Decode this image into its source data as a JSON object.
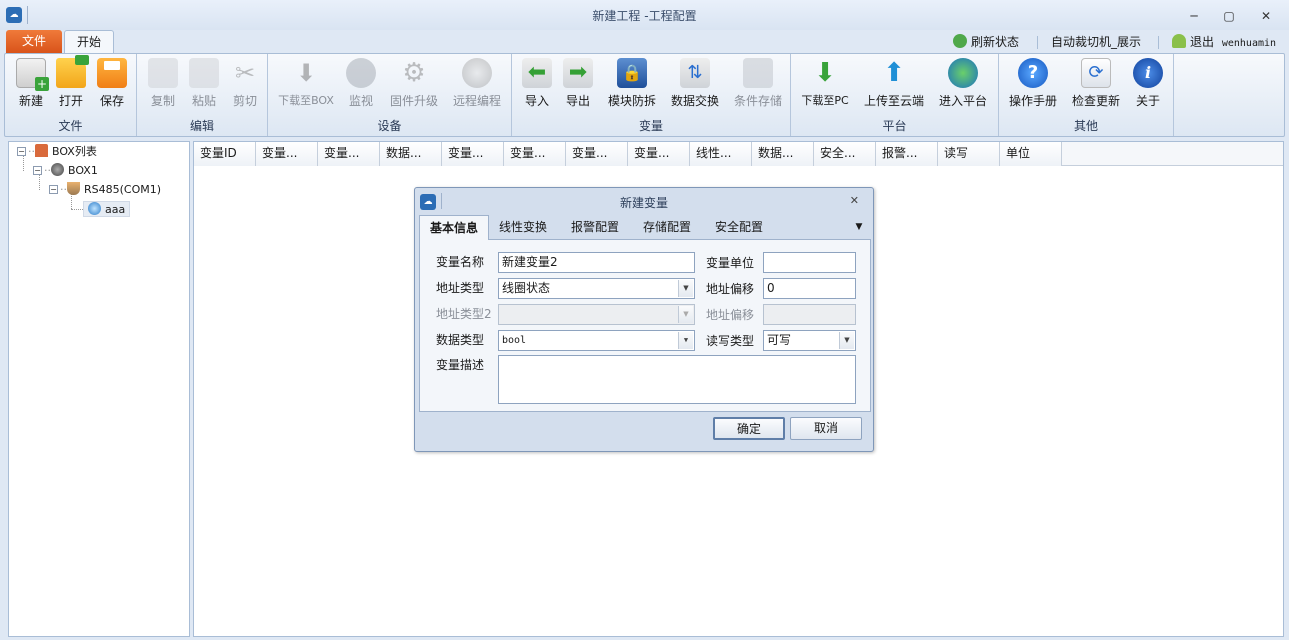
{
  "window": {
    "title": "新建工程 -工程配置",
    "minimize": "─",
    "maximize": "▢",
    "close": "✕"
  },
  "menu_tabs": {
    "file": "文件",
    "start": "开始"
  },
  "quick": {
    "refresh": "刷新状态",
    "project": "自动裁切机_展示",
    "logout": "退出",
    "user": "wenhuamin"
  },
  "ribbon": {
    "groups": {
      "file": "文件",
      "edit": "编辑",
      "device": "设备",
      "variable": "变量",
      "platform": "平台",
      "other": "其他"
    },
    "buttons": {
      "new": "新建",
      "open": "打开",
      "save": "保存",
      "copy": "复制",
      "paste": "粘贴",
      "cut": "剪切",
      "download_box": "下载至BOX",
      "monitor": "监视",
      "firmware": "固件升级",
      "remote": "远程编程",
      "import": "导入",
      "export": "导出",
      "module_protect": "模块防拆",
      "data_exchange": "数据交换",
      "cond_storage": "条件存储",
      "download_pc": "下载至PC",
      "upload_cloud": "上传至云端",
      "enter_platform": "进入平台",
      "manual": "操作手册",
      "check_update": "检查更新",
      "about": "关于"
    },
    "colors": {
      "accent_orange": "#e5682a",
      "blue": "#2a6fd0",
      "green": "#3aa53a"
    }
  },
  "tree": {
    "root": "BOX列表",
    "box": "BOX1",
    "port": "RS485(COM1)",
    "item": "aaa"
  },
  "grid": {
    "columns": [
      "变量ID",
      "变量...",
      "变量...",
      "数据...",
      "变量...",
      "变量...",
      "变量...",
      "变量...",
      "线性...",
      "数据...",
      "安全...",
      "报警...",
      "读写",
      "单位"
    ]
  },
  "dialog": {
    "title": "新建变量",
    "close": "✕",
    "tabs": [
      "基本信息",
      "线性变换",
      "报警配置",
      "存储配置",
      "安全配置"
    ],
    "more": "▼",
    "labels": {
      "var_name": "变量名称",
      "var_unit": "变量单位",
      "addr_type": "地址类型",
      "addr_offset": "地址偏移",
      "addr_type2": "地址类型2",
      "addr_offset2": "地址偏移",
      "data_type": "数据类型",
      "rw_type": "读写类型",
      "desc": "变量描述"
    },
    "values": {
      "var_name": "新建变量2",
      "var_unit": "",
      "addr_type": "线圈状态",
      "addr_offset": "0",
      "addr_type2": "",
      "addr_offset2": "",
      "data_type": "bool",
      "rw_type": "可写",
      "desc": ""
    },
    "buttons": {
      "ok": "确定",
      "cancel": "取消"
    }
  }
}
